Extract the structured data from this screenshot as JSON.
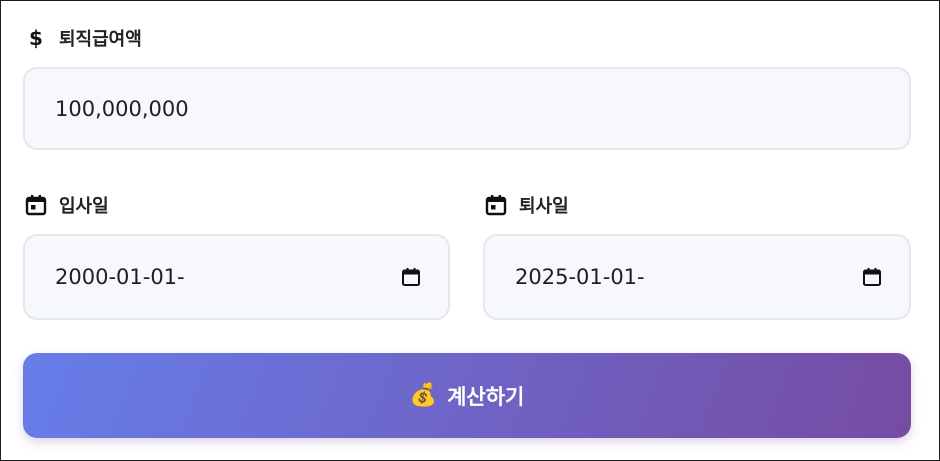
{
  "form": {
    "amount": {
      "icon": "dollar-icon",
      "label": "퇴직급여액",
      "value": "100,000,000"
    },
    "start_date": {
      "icon": "calendar-icon",
      "label": "입사일",
      "value": "2000-01-01-"
    },
    "end_date": {
      "icon": "calendar-icon",
      "label": "퇴사일",
      "value": "2025-01-01-"
    },
    "submit": {
      "icon": "money-bag-icon",
      "emoji": "💰",
      "label": "계산하기"
    }
  },
  "colors": {
    "gradient_start": "#667eea",
    "gradient_end": "#764ba2",
    "field_bg": "#f6f8fb",
    "field_border": "#e3e8ee"
  }
}
